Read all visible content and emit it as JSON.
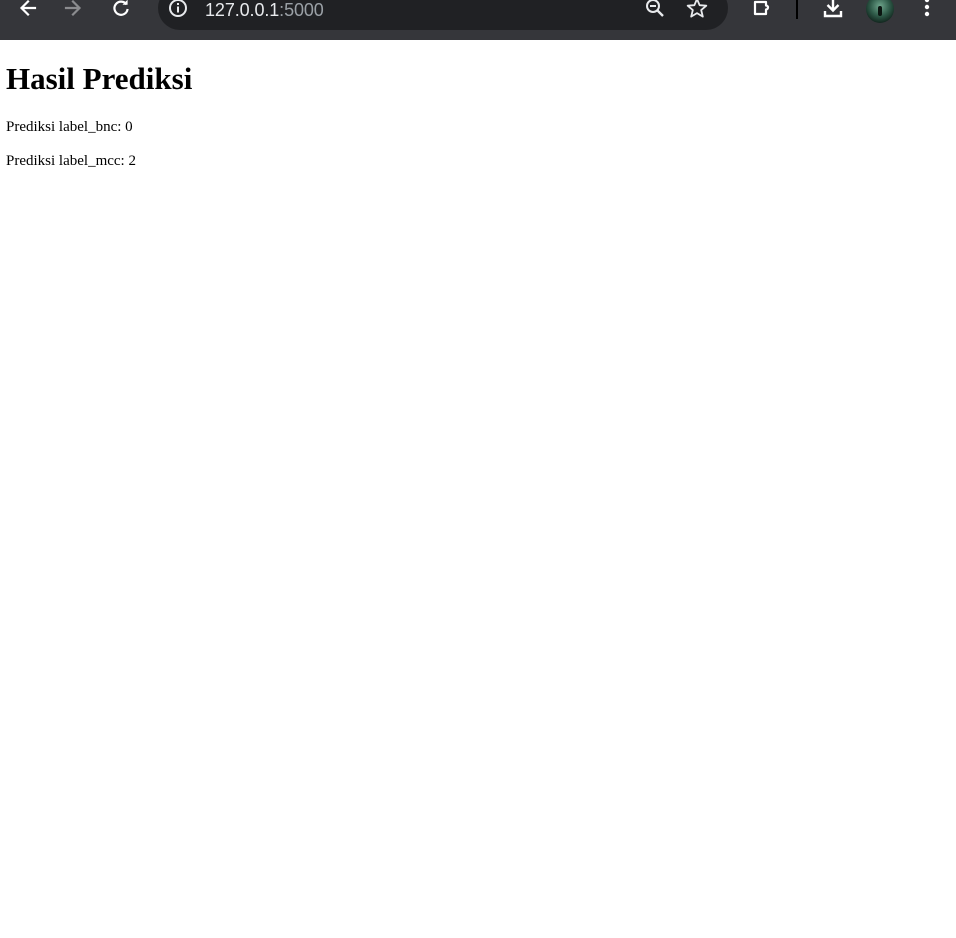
{
  "browser": {
    "url_host": "127.0.0.1",
    "url_port": ":5000",
    "icons": {
      "back": "arrow-left-icon",
      "forward": "arrow-right-icon",
      "reload": "reload-icon",
      "site_info": "info-icon",
      "zoom": "zoom-out-icon",
      "bookmark": "star-icon",
      "extensions": "puzzle-icon",
      "download": "download-icon",
      "profile": "avatar",
      "menu": "kebab-menu-icon"
    }
  },
  "page": {
    "title": "Hasil Prediksi",
    "lines": [
      "Prediksi label_bnc: 0",
      "Prediksi label_mcc: 2"
    ]
  }
}
